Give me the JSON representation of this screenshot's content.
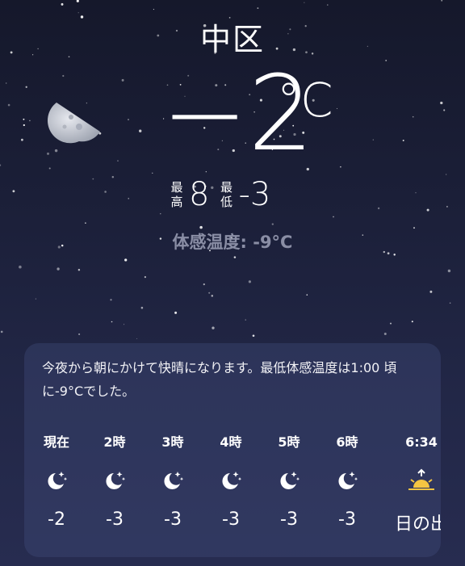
{
  "location": "中区",
  "current": {
    "temp": "−2",
    "unit": "°C",
    "high_label_1": "最",
    "high_label_2": "高",
    "high": "8",
    "low_label_1": "最",
    "low_label_2": "低",
    "low": "-3",
    "feels_like": "体感温度: -9°C"
  },
  "summary_line1": "今夜から朝にかけて快晴になります。最低体感温度は1:00 頃",
  "summary_line2": "に-9°Cでした。",
  "hourly": [
    {
      "time": "現在",
      "icon": "moon-stars-icon",
      "value": "-2"
    },
    {
      "time": "2時",
      "icon": "moon-stars-icon",
      "value": "-3"
    },
    {
      "time": "3時",
      "icon": "moon-stars-icon",
      "value": "-3"
    },
    {
      "time": "4時",
      "icon": "moon-stars-icon",
      "value": "-3"
    },
    {
      "time": "5時",
      "icon": "moon-stars-icon",
      "value": "-3"
    },
    {
      "time": "6時",
      "icon": "moon-stars-icon",
      "value": "-3"
    },
    {
      "time": "6:34",
      "icon": "sunrise-icon",
      "value": "日の出"
    }
  ],
  "colors": {
    "accent_sun": "#f5c542",
    "feels_text": "#8a8ea5"
  }
}
